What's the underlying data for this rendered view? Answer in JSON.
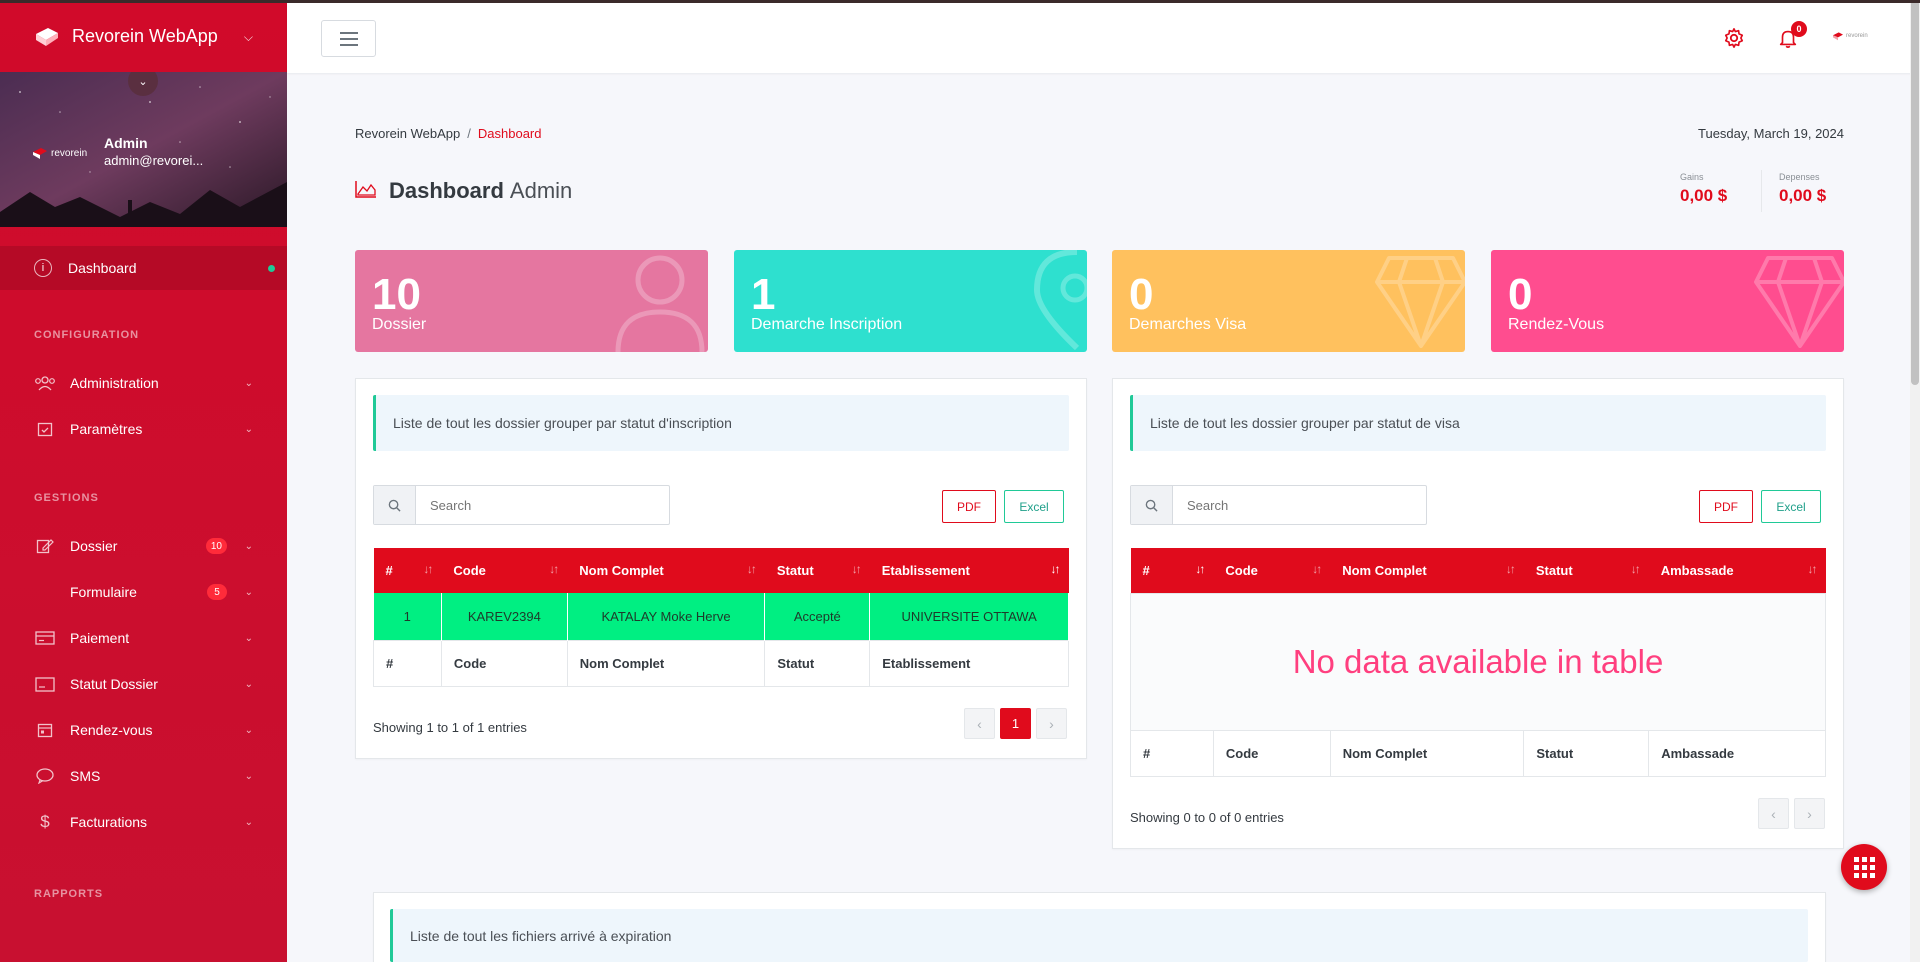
{
  "app": {
    "name": "Revorein WebApp"
  },
  "profile": {
    "name": "Admin",
    "email": "admin@revorei...",
    "logo_text": "revorein"
  },
  "sidebar": {
    "active": {
      "label": "Dashboard",
      "icon": "info-icon"
    },
    "sections": [
      {
        "title": "CONFIGURATION",
        "items": [
          {
            "label": "Administration",
            "icon": "users-icon"
          },
          {
            "label": "Paramètres",
            "icon": "calendar-check-icon"
          }
        ]
      },
      {
        "title": "GESTIONS",
        "items": [
          {
            "label": "Dossier",
            "icon": "edit-icon",
            "badge": "10"
          },
          {
            "label": "Formulaire",
            "icon": "",
            "badge": "5"
          },
          {
            "label": "Paiement",
            "icon": "credit-card-icon"
          },
          {
            "label": "Statut Dossier",
            "icon": "monitor-icon"
          },
          {
            "label": "Rendez-vous",
            "icon": "calendar-icon"
          },
          {
            "label": "SMS",
            "icon": "sms-icon"
          },
          {
            "label": "Facturations",
            "icon": "dollar-icon"
          }
        ]
      },
      {
        "title": "RAPPORTS",
        "items": []
      }
    ]
  },
  "header": {
    "notification_count": "0",
    "logo_text": "revorein"
  },
  "breadcrumb": {
    "root": "Revorein WebApp",
    "separator": "/",
    "current": "Dashboard"
  },
  "date": "Tuesday, March 19, 2024",
  "page_title": {
    "strong": "Dashboard",
    "light": "Admin"
  },
  "mini_stats": [
    {
      "label": "Gains",
      "value": "0,00 $"
    },
    {
      "label": "Depenses",
      "value": "0,00 $"
    }
  ],
  "tiles": [
    {
      "value": "10",
      "label": "Dossier",
      "color": "#e576a0",
      "icon": "user-icon"
    },
    {
      "value": "1",
      "label": "Demarche Inscription",
      "color": "#2ee0cf",
      "icon": "map-pin-icon"
    },
    {
      "value": "0",
      "label": "Demarches Visa",
      "color": "#ffc15e",
      "icon": "diamond-icon"
    },
    {
      "value": "0",
      "label": "Rendez-Vous",
      "color": "#ff4d8f",
      "icon": "diamond-icon"
    }
  ],
  "inscription_card": {
    "callout": "Liste de tout les dossier grouper par statut d'inscription",
    "search_placeholder": "Search",
    "pdf": "PDF",
    "excel": "Excel",
    "columns": [
      "#",
      "Code",
      "Nom Complet",
      "Statut",
      "Etablissement"
    ],
    "rows": [
      [
        "1",
        "KAREV2394",
        "KATALAY Moke Herve",
        "Accepté",
        "UNIVERSITE OTTAWA"
      ]
    ],
    "showing": "Showing 1 to 1 of 1 entries",
    "current_page": "1"
  },
  "visa_card": {
    "callout": "Liste de tout les dossier grouper par statut de visa",
    "search_placeholder": "Search",
    "pdf": "PDF",
    "excel": "Excel",
    "columns": [
      "#",
      "Code",
      "Nom Complet",
      "Statut",
      "Ambassade"
    ],
    "empty_text": "No data available in table",
    "showing": "Showing 0 to 0 of 0 entries"
  },
  "expiration_card": {
    "callout": "Liste de tout les fichiers arrivé à expiration"
  },
  "colors": {
    "primary": "#e00b1c",
    "accent": "#20c997",
    "success_row": "#00ef82"
  }
}
